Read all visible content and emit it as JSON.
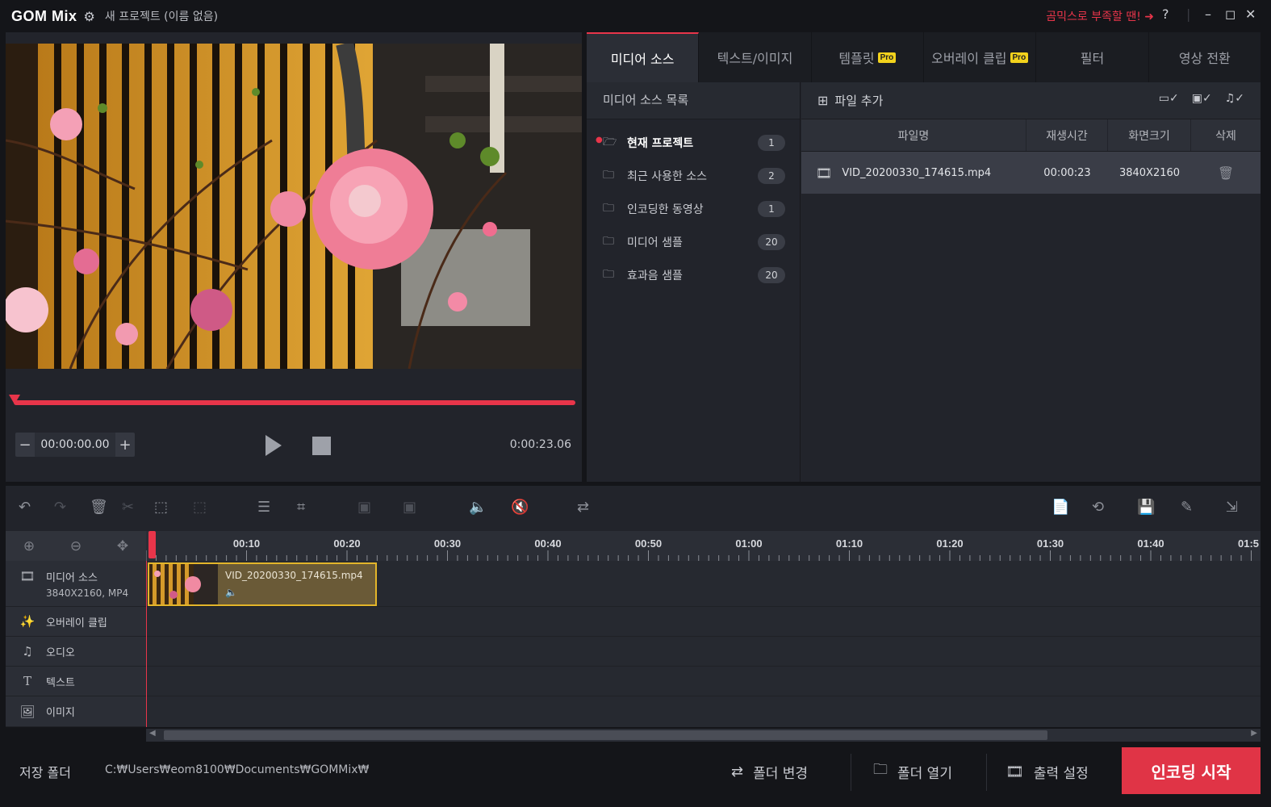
{
  "app": {
    "logo": "GOM Mix",
    "project_title": "새 프로젝트 (이름 없음)",
    "promo_text": "곰믹스로 부족할 땐! ➜",
    "help": "?",
    "minimize": "–",
    "maximize": "◻",
    "close": "✕"
  },
  "preview": {
    "current_time": "00:00:00.00",
    "minus": "−",
    "plus": "+",
    "duration": "0:00:23.06",
    "progress": 0.0
  },
  "tabs": [
    {
      "label": "미디어 소스"
    },
    {
      "label": "텍스트/이미지"
    },
    {
      "label": "템플릿",
      "badge": "Pro"
    },
    {
      "label": "오버레이 클립",
      "badge": "Pro"
    },
    {
      "label": "필터"
    },
    {
      "label": "영상 전환"
    }
  ],
  "source_list": {
    "header": "미디어 소스 목록",
    "items": [
      {
        "label": "현재 프로젝트",
        "count": "1",
        "icon": "folder-open-icon"
      },
      {
        "label": "최근 사용한 소스",
        "count": "2",
        "icon": "folder-icon"
      },
      {
        "label": "인코딩한 동영상",
        "count": "1",
        "icon": "folder-encode-icon"
      },
      {
        "label": "미디어 샘플",
        "count": "20",
        "icon": "folder-icon"
      },
      {
        "label": "효과음 샘플",
        "count": "20",
        "icon": "folder-icon"
      }
    ]
  },
  "files": {
    "add_label": "파일 추가",
    "columns": {
      "name": "파일명",
      "duration": "재생시간",
      "size": "화면크기",
      "delete": "삭제"
    },
    "rows": [
      {
        "name": "VID_20200330_174615.mp4",
        "duration": "00:00:23",
        "size": "3840X2160"
      }
    ]
  },
  "timeline": {
    "ticks": [
      "00:10",
      "00:20",
      "00:30",
      "00:40",
      "00:50",
      "01:00",
      "01:10",
      "01:20",
      "01:30",
      "01:40",
      "01:5"
    ],
    "tracks": [
      {
        "label": "미디어 소스",
        "sub": "3840X2160, MP4",
        "icon": "film-icon"
      },
      {
        "label": "오버레이 클립",
        "icon": "magic-icon"
      },
      {
        "label": "오디오",
        "icon": "music-icon"
      },
      {
        "label": "텍스트",
        "icon": "text-icon"
      },
      {
        "label": "이미지",
        "icon": "image-icon"
      }
    ],
    "clip": {
      "name": "VID_20200330_174615.mp4",
      "volume_icon": "🔈"
    }
  },
  "bottom": {
    "save_folder_label": "저장 폴더",
    "save_path": "C:₩Users₩eom8100₩Documents₩GOMMix₩",
    "change_folder": "폴더 변경",
    "open_folder": "폴더 열기",
    "output_settings": "출력 설정",
    "encode_start": "인코딩 시작"
  },
  "colors": {
    "accent": "#e8354a",
    "clip_border": "#e3b52a",
    "pro_badge": "#f2d21c"
  }
}
